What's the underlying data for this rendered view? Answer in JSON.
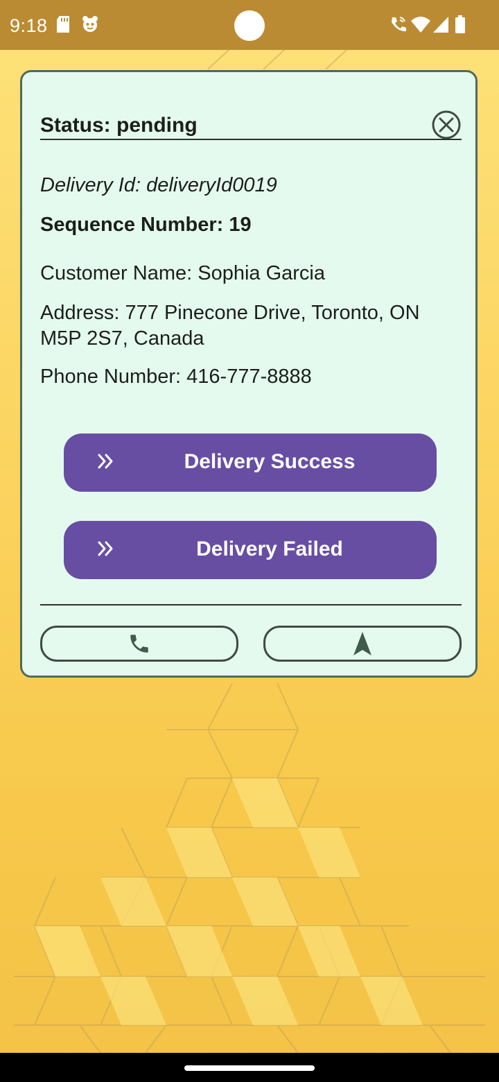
{
  "status_bar": {
    "time": "9:18",
    "icons": [
      "sd-card-icon",
      "app-notification-icon",
      "wifi-calling-icon",
      "wifi-icon",
      "signal-icon",
      "battery-icon"
    ]
  },
  "card": {
    "status_title": "Status: pending",
    "delivery_id": "Delivery Id: deliveryId0019",
    "sequence_number": "Sequence Number: 19",
    "customer_name": "Customer Name: Sophia Garcia",
    "address": "Address: 777 Pinecone Drive, Toronto, ON M5P 2S7, Canada",
    "phone_number": "Phone Number: 416-777-8888",
    "success_button": "Delivery Success",
    "failed_button": "Delivery Failed",
    "call_button_icon": "phone-icon",
    "navigate_button_icon": "navigation-arrow-icon",
    "close_icon": "close-circle-icon"
  },
  "colors": {
    "status_bar": "#bb8b33",
    "card_background": "#e5faee",
    "card_border": "#4f6a5c",
    "primary_button": "#674ea3",
    "background": "#f6c94e"
  }
}
